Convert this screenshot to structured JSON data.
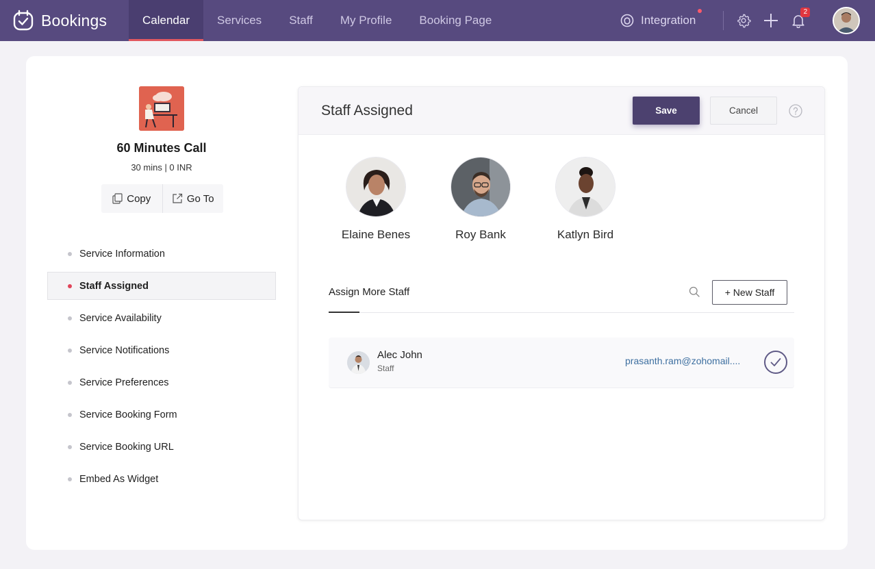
{
  "app": {
    "name": "Bookings",
    "nav_tabs": [
      {
        "label": "Calendar",
        "active": true
      },
      {
        "label": "Services",
        "active": false
      },
      {
        "label": "Staff",
        "active": false
      },
      {
        "label": "My Profile",
        "active": false
      },
      {
        "label": "Booking Page",
        "active": false
      }
    ],
    "integration_label": "Integration",
    "notification_count": "2",
    "icons": {
      "logo": "bookings-logo-icon",
      "integration": "integration-icon",
      "settings": "gear-icon",
      "add": "plus-icon",
      "notifications": "bell-icon",
      "profile": "user-avatar"
    }
  },
  "service": {
    "title": "60 Minutes Call",
    "subtitle": "30 mins | 0 INR",
    "copy_label": "Copy",
    "goto_label": "Go To"
  },
  "menu": [
    {
      "label": "Service Information",
      "active": false
    },
    {
      "label": "Staff Assigned",
      "active": true
    },
    {
      "label": "Service Availability",
      "active": false
    },
    {
      "label": "Service Notifications",
      "active": false
    },
    {
      "label": "Service Preferences",
      "active": false
    },
    {
      "label": "Service Booking Form",
      "active": false
    },
    {
      "label": "Service Booking URL",
      "active": false
    },
    {
      "label": "Embed As Widget",
      "active": false
    }
  ],
  "panel": {
    "title": "Staff Assigned",
    "save_label": "Save",
    "cancel_label": "Cancel",
    "assigned_staff": [
      {
        "name": "Elaine Benes"
      },
      {
        "name": "Roy Bank"
      },
      {
        "name": "Katlyn Bird"
      }
    ],
    "assign_more_title": "Assign More Staff",
    "new_staff_label": "+ New Staff",
    "available_staff": [
      {
        "name": "Alec John",
        "role": "Staff",
        "email": "prasanth.ram@zohomail....",
        "selected": true
      }
    ]
  },
  "colors": {
    "topbar": "#574a7f",
    "accent": "#e2585f",
    "save_button": "#4c416f",
    "email_link": "#3d6fa0"
  }
}
